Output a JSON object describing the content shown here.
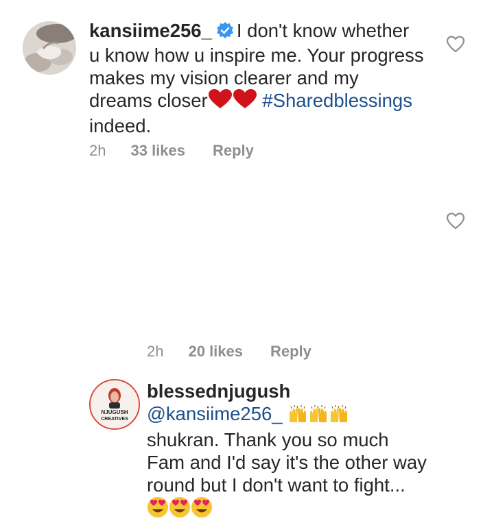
{
  "comments": [
    {
      "username": "kansiime256_",
      "verified": true,
      "text_line1": "I don't know whether",
      "text_line2": "u know how u inspire me. Your progress",
      "text_line3": "makes my vision clearer and my",
      "text_line4_prefix": "dreams closer",
      "hashtag": "#Sharedblessings",
      "text_line5": "indeed.",
      "time": "2h",
      "likes": "33 likes",
      "reply_label": "Reply"
    },
    {
      "username": "blessednjugush",
      "mention": "@kansiime256_",
      "text_line2": "shukran. Thank you so much",
      "text_line3": "Fam and I'd say it's the other way",
      "text_line4": "round but I don't want to fight...",
      "avatar_text_top": "NJUGUSH",
      "avatar_text_bottom": "CREATIVES",
      "time": "2h",
      "likes": "20 likes",
      "reply_label": "Reply"
    }
  ],
  "colors": {
    "text": "#262626",
    "meta": "#8e8e8e",
    "link": "#1d4f8c",
    "verified": "#3897f0",
    "heart": "#d0121b"
  },
  "icons": [
    "verified-badge-icon",
    "heart-emoji-icon",
    "raising-hands-emoji-icon",
    "heart-eyes-emoji-icon",
    "like-heart-icon"
  ]
}
